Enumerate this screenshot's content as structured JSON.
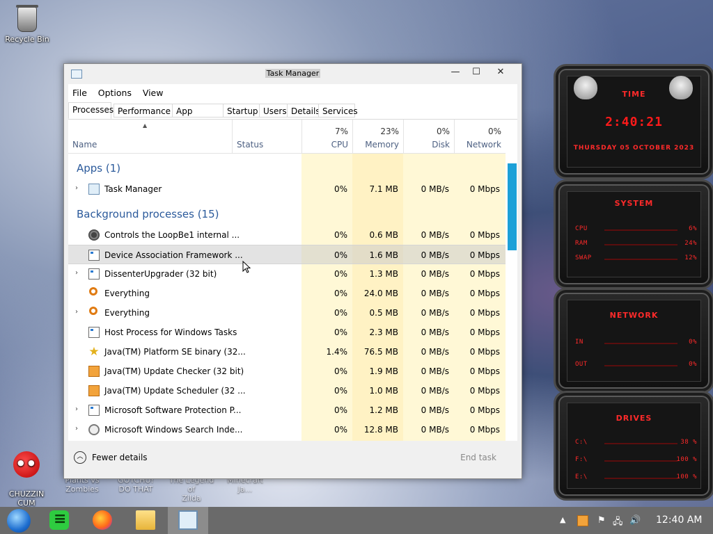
{
  "desktop": {
    "recycle_bin": "Recycle Bin",
    "chuzz": "CHUZZIN\nCUM",
    "ghost_labels": [
      "Plants vs\nZombies",
      "GOTCHU!\nDO THAT",
      "The Legend of\nZilda",
      "Minecraft Ja..."
    ]
  },
  "window": {
    "title": "Task Manager",
    "controls": {
      "minimize": "—",
      "maximize": "☐",
      "close": "✕"
    },
    "menu": [
      "File",
      "Options",
      "View"
    ],
    "tabs": [
      "Processes",
      "Performance",
      "App history",
      "Startup",
      "Users",
      "Details",
      "Services"
    ],
    "columns": {
      "name": "Name",
      "status": "Status",
      "cpu": {
        "pct": "7%",
        "label": "CPU"
      },
      "memory": {
        "pct": "23%",
        "label": "Memory"
      },
      "disk": {
        "pct": "0%",
        "label": "Disk"
      },
      "network": {
        "pct": "0%",
        "label": "Network"
      }
    },
    "groups": {
      "apps": "Apps (1)",
      "background": "Background processes (15)"
    },
    "apps": [
      {
        "name": "Task Manager",
        "cpu": "0%",
        "mem": "7.1 MB",
        "disk": "0 MB/s",
        "net": "0 Mbps",
        "icon": "task-manager-icon",
        "expand": true
      }
    ],
    "background": [
      {
        "name": "Controls the LoopBe1 internal ...",
        "cpu": "0%",
        "mem": "0.6 MB",
        "disk": "0 MB/s",
        "net": "0 Mbps",
        "icon": "gear-icon",
        "expand": false
      },
      {
        "name": "Device Association Framework ...",
        "cpu": "0%",
        "mem": "1.6 MB",
        "disk": "0 MB/s",
        "net": "0 Mbps",
        "icon": "window-icon",
        "expand": false
      },
      {
        "name": "DissenterUpgrader (32 bit)",
        "cpu": "0%",
        "mem": "1.3 MB",
        "disk": "0 MB/s",
        "net": "0 Mbps",
        "icon": "window-icon",
        "expand": true
      },
      {
        "name": "Everything",
        "cpu": "0%",
        "mem": "24.0 MB",
        "disk": "0 MB/s",
        "net": "0 Mbps",
        "icon": "search-icon",
        "expand": false
      },
      {
        "name": "Everything",
        "cpu": "0%",
        "mem": "0.5 MB",
        "disk": "0 MB/s",
        "net": "0 Mbps",
        "icon": "search-icon",
        "expand": true
      },
      {
        "name": "Host Process for Windows Tasks",
        "cpu": "0%",
        "mem": "2.3 MB",
        "disk": "0 MB/s",
        "net": "0 Mbps",
        "icon": "window-icon",
        "expand": false
      },
      {
        "name": "Java(TM) Platform SE binary (32...",
        "cpu": "1.4%",
        "mem": "76.5 MB",
        "disk": "0 MB/s",
        "net": "0 Mbps",
        "icon": "star-icon",
        "expand": false
      },
      {
        "name": "Java(TM) Update Checker (32 bit)",
        "cpu": "0%",
        "mem": "1.9 MB",
        "disk": "0 MB/s",
        "net": "0 Mbps",
        "icon": "java-icon",
        "expand": false
      },
      {
        "name": "Java(TM) Update Scheduler (32 ...",
        "cpu": "0%",
        "mem": "1.0 MB",
        "disk": "0 MB/s",
        "net": "0 Mbps",
        "icon": "java-icon",
        "expand": false
      },
      {
        "name": "Microsoft Software Protection P...",
        "cpu": "0%",
        "mem": "1.2 MB",
        "disk": "0 MB/s",
        "net": "0 Mbps",
        "icon": "window-icon",
        "expand": true
      },
      {
        "name": "Microsoft Windows Search Inde...",
        "cpu": "0%",
        "mem": "12.8 MB",
        "disk": "0 MB/s",
        "net": "0 Mbps",
        "icon": "user-icon",
        "expand": true
      }
    ],
    "footer": {
      "fewer": "Fewer details",
      "end_task": "End task"
    }
  },
  "gadget": {
    "time_title": "TIME",
    "time": "2:40:21",
    "date": "THURSDAY 05 OCTOBER 2023",
    "system_title": "SYSTEM",
    "system": [
      {
        "label": "CPU",
        "value": "6%"
      },
      {
        "label": "RAM",
        "value": "24%"
      },
      {
        "label": "SWAP",
        "value": "12%"
      }
    ],
    "network_title": "NETWORK",
    "network": [
      {
        "label": "IN",
        "value": "0%"
      },
      {
        "label": "OUT",
        "value": "0%"
      }
    ],
    "drives_title": "DRIVES",
    "drives": [
      {
        "label": "C:\\",
        "value": "38 %"
      },
      {
        "label": "F:\\",
        "value": "100 %"
      },
      {
        "label": "E:\\",
        "value": "100 %"
      }
    ]
  },
  "taskbar": {
    "clock": "12:40 AM",
    "tray": [
      "▲",
      "⚑",
      "🖧",
      "🔊"
    ]
  }
}
